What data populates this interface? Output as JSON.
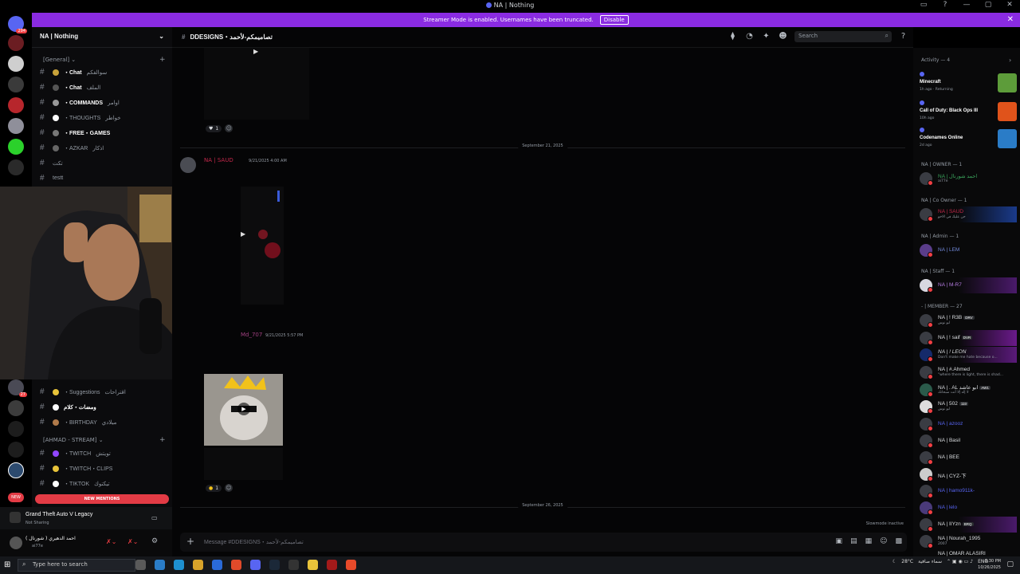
{
  "window": {
    "title": "NA | Nothing"
  },
  "streamer": {
    "message": "Streamer Mode is enabled. Usernames have been truncated.",
    "disable_label": "Disable"
  },
  "server": {
    "name": "NA | Nothing"
  },
  "channels": {
    "category_general": "[General]",
    "items": [
      {
        "name": "・Chat",
        "arabic": "سوالفكم"
      },
      {
        "name": "・Chat",
        "arabic": "الملف"
      },
      {
        "name": "・COMMANDS",
        "arabic": "اوامر"
      },
      {
        "name": "・THOUGHTS",
        "arabic": "خواطر"
      },
      {
        "name": "・FREE・GAMES",
        "arabic": ""
      },
      {
        "name": "・AZKAR",
        "arabic": "اذكار"
      },
      {
        "name": "تكت",
        "arabic": ""
      },
      {
        "name": "testt",
        "arabic": ""
      }
    ],
    "lower_items": [
      {
        "name": "・Suggestions",
        "arabic": "اقتراحات"
      },
      {
        "name": "ومضات・كلام",
        "arabic": ""
      },
      {
        "name": "・BIRTHDAY",
        "arabic": "ميلادي"
      }
    ],
    "category_stream": "[AHMAD - STREAM]",
    "stream_items": [
      {
        "name": "・TWITCH",
        "arabic": "تويتش"
      },
      {
        "name": "・TWITCH・CLIPS",
        "arabic": ""
      },
      {
        "name": "・TIKTOK",
        "arabic": "تيكتوك"
      }
    ],
    "new_mentions": "NEW MENTIONS"
  },
  "activity_bar": {
    "game": "Grand Theft Auto V Legacy",
    "status": "Not Sharing"
  },
  "user": {
    "name": "احمد الدهيري ( شورنال )",
    "status": "ai77e"
  },
  "main": {
    "channel_name": "DDESIGNS・تصاميمكم-لأحمد",
    "search_placeholder": "Search",
    "divider1": "September 21, 2025",
    "msg1_author": "NA | SAUD",
    "msg1_time": "9/21/2025 4:00 AM",
    "msg2_author": "Md_707",
    "msg2_time": "9/21/2025 5:57 PM",
    "reaction1_count": "1",
    "reaction2_count": "1",
    "divider2": "September 26, 2025",
    "slowmode": "Slowmode inactive",
    "composer_placeholder": "Message #DDESIGNS・تصاميمكم-لأحمد"
  },
  "members": {
    "activity_header": "Activity — 4",
    "activities": [
      {
        "game": "Minecraft",
        "sub": "1h ago · Returning",
        "color": "#5d9c3a"
      },
      {
        "game": "Call of Duty: Black Ops III",
        "sub": "10h ago",
        "color": "#e0531b"
      },
      {
        "game": "Codenames Online",
        "sub": "2d ago",
        "color": "#2a7cc7"
      }
    ],
    "groups": [
      {
        "label": "NA | OWNER — 1",
        "members": [
          {
            "name": "NA | احمد شورنال",
            "status": "ai77e",
            "color": "#3ba55d"
          }
        ]
      },
      {
        "label": "NA | Co Owner — 1",
        "members": [
          {
            "name": "NA | SAUD",
            "status": "حن عليك في الاخو",
            "color": "#c4284b"
          }
        ]
      },
      {
        "label": "NA | Admin — 1",
        "members": [
          {
            "name": "NA | LEM",
            "status": "",
            "color": "#7289da"
          }
        ]
      },
      {
        "label": "NA | Staff — 1",
        "members": [
          {
            "name": "NA | M-R7",
            "status": "",
            "color": "#9b59b6"
          }
        ]
      },
      {
        "label": "- | MEMBER — 27",
        "members": [
          {
            "name": "NA | ! R3B",
            "status": "ابو نوس",
            "tag": "DRV"
          },
          {
            "name": "NA | ! saif",
            "status": "",
            "tag": "DVR"
          },
          {
            "name": "NA | ! LEON",
            "status": "Don't make me hate because o..."
          },
          {
            "name": "NA | #.Ahmed",
            "status": "\"where there is light, there is shad..."
          },
          {
            "name": "NA | . AL ابو عاشد",
            "status": "لا إله إلا أنت سبحانك",
            "tag": "AW1"
          },
          {
            "name": "NA | 502",
            "status": "ابو نوس",
            "tag": "11tr"
          },
          {
            "name": "NA | azooz",
            "status": ""
          },
          {
            "name": "NA | Basil",
            "status": ""
          },
          {
            "name": "NA | BEE",
            "status": ""
          },
          {
            "name": "NA | CYZ-下",
            "status": ""
          },
          {
            "name": "NA | hamo911k-",
            "status": ""
          },
          {
            "name": "NA | lelo",
            "status": ""
          },
          {
            "name": "NA | IIYzn",
            "status": "",
            "tag": "BRQ"
          },
          {
            "name": "NA | Nourah_1995",
            "status": "2007"
          },
          {
            "name": "NA | OMAR ALASIRI",
            "status": ""
          }
        ]
      }
    ]
  },
  "taskbar": {
    "search_placeholder": "Type here to search",
    "weather": "28°C",
    "weather_text": "سماء صافية",
    "lang": "ENG",
    "time": "9:30 PM",
    "date": "10/26/2025"
  }
}
